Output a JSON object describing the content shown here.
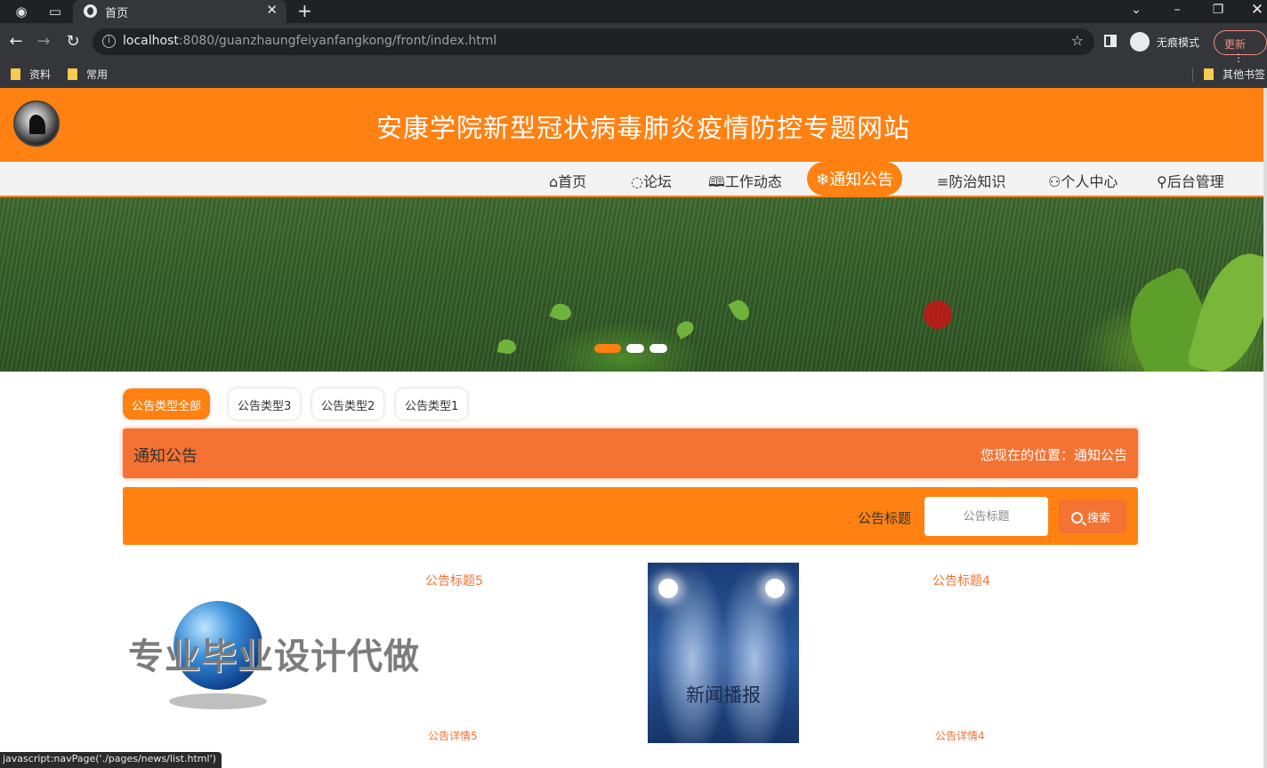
{
  "browser": {
    "tab_title": "首页",
    "url_host": "localhost",
    "url_rest": ":8080/guanzhaungfeiyanfangkong/front/index.html",
    "incognito_label": "无痕模式",
    "update_label": "更新",
    "bookmarks": [
      "资料",
      "常用"
    ],
    "other_bookmarks": "其他书签",
    "status_text": "javascript:navPage('./pages/news/list.html')"
  },
  "site": {
    "title": "安康学院新型冠状病毒肺炎疫情防控专题网站",
    "nav": [
      {
        "icon": "⌂",
        "label": "首页"
      },
      {
        "icon": "◌",
        "label": "论坛"
      },
      {
        "icon": "🕮",
        "label": "工作动态"
      },
      {
        "icon": "❄",
        "label": "通知公告"
      },
      {
        "icon": "≡",
        "label": "防治知识"
      },
      {
        "icon": "⚇",
        "label": "个人中心"
      },
      {
        "icon": "⚲",
        "label": "后台管理"
      }
    ],
    "active_nav": "通知公告",
    "accent_color": "#fe8112",
    "section_color": "#f47232"
  },
  "categories": [
    "公告类型全部",
    "公告类型3",
    "公告类型2",
    "公告类型1"
  ],
  "section": {
    "title": "通知公告",
    "breadcrumb": "您现在的位置：通知公告"
  },
  "search": {
    "label": "公告标题",
    "placeholder": "公告标题",
    "button": "搜索"
  },
  "news": [
    {
      "title": "公告标题5",
      "desc": "公告详情5",
      "image_text": "专业毕业设计代做"
    },
    {
      "title": "公告标题4",
      "desc": "公告详情4",
      "image_text": "新闻播报"
    }
  ]
}
